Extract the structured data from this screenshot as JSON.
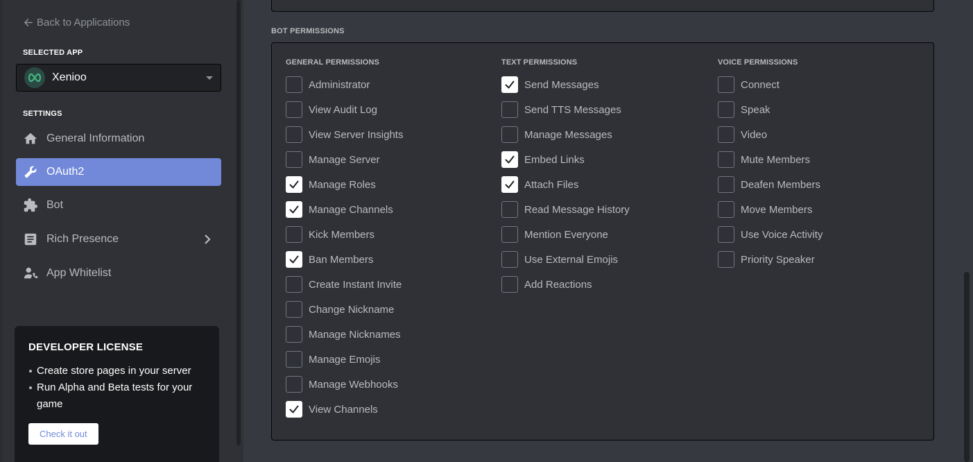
{
  "sidebar": {
    "back_label": "Back to Applications",
    "selected_app_label": "SELECTED APP",
    "app_name": "Xenioo",
    "settings_label": "SETTINGS",
    "items": [
      {
        "label": "General Information",
        "icon": "home-icon"
      },
      {
        "label": "OAuth2",
        "icon": "wrench-icon",
        "active": true
      },
      {
        "label": "Bot",
        "icon": "puzzle-icon"
      },
      {
        "label": "Rich Presence",
        "icon": "document-icon"
      },
      {
        "label": "App Whitelist",
        "icon": "user-phone-icon"
      }
    ],
    "license": {
      "title": "DEVELOPER LICENSE",
      "bullets": [
        "Create store pages in your server",
        "Run Alpha and Beta tests for your game"
      ],
      "button": "Check it out"
    }
  },
  "permissions": {
    "heading": "BOT PERMISSIONS",
    "columns": [
      {
        "title": "GENERAL PERMISSIONS",
        "items": [
          {
            "label": "Administrator",
            "checked": false
          },
          {
            "label": "View Audit Log",
            "checked": false
          },
          {
            "label": "View Server Insights",
            "checked": false
          },
          {
            "label": "Manage Server",
            "checked": false
          },
          {
            "label": "Manage Roles",
            "checked": true
          },
          {
            "label": "Manage Channels",
            "checked": true
          },
          {
            "label": "Kick Members",
            "checked": false
          },
          {
            "label": "Ban Members",
            "checked": true
          },
          {
            "label": "Create Instant Invite",
            "checked": false
          },
          {
            "label": "Change Nickname",
            "checked": false
          },
          {
            "label": "Manage Nicknames",
            "checked": false
          },
          {
            "label": "Manage Emojis",
            "checked": false
          },
          {
            "label": "Manage Webhooks",
            "checked": false
          },
          {
            "label": "View Channels",
            "checked": true
          }
        ]
      },
      {
        "title": "TEXT PERMISSIONS",
        "items": [
          {
            "label": "Send Messages",
            "checked": true
          },
          {
            "label": "Send TTS Messages",
            "checked": false
          },
          {
            "label": "Manage Messages",
            "checked": false
          },
          {
            "label": "Embed Links",
            "checked": true
          },
          {
            "label": "Attach Files",
            "checked": true
          },
          {
            "label": "Read Message History",
            "checked": false
          },
          {
            "label": "Mention Everyone",
            "checked": false
          },
          {
            "label": "Use External Emojis",
            "checked": false
          },
          {
            "label": "Add Reactions",
            "checked": false
          }
        ]
      },
      {
        "title": "VOICE PERMISSIONS",
        "items": [
          {
            "label": "Connect",
            "checked": false
          },
          {
            "label": "Speak",
            "checked": false
          },
          {
            "label": "Video",
            "checked": false
          },
          {
            "label": "Mute Members",
            "checked": false
          },
          {
            "label": "Deafen Members",
            "checked": false
          },
          {
            "label": "Move Members",
            "checked": false
          },
          {
            "label": "Use Voice Activity",
            "checked": false
          },
          {
            "label": "Priority Speaker",
            "checked": false
          }
        ]
      }
    ]
  },
  "colors": {
    "accent": "#7289da",
    "sidebar_bg": "#2f3136",
    "main_bg": "#36393f",
    "license_bg": "#18191c"
  }
}
